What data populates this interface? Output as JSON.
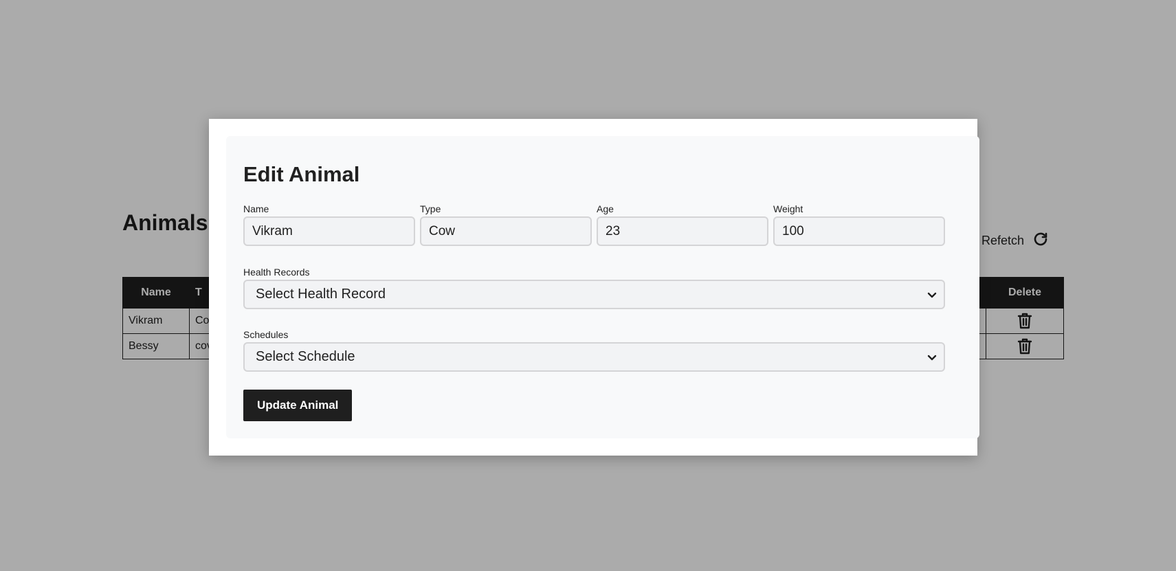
{
  "page": {
    "title": "Animals",
    "refetch_label": "Refetch",
    "refetch_icon": "refresh-icon"
  },
  "table": {
    "columns": [
      "Name",
      "T",
      "Delete"
    ],
    "rows": [
      {
        "name": "Vikram",
        "type": "Co"
      },
      {
        "name": "Bessy",
        "type": "cov"
      }
    ],
    "delete_icon": "trash-icon"
  },
  "modal": {
    "title": "Edit Animal",
    "fields": {
      "name": {
        "label": "Name",
        "value": "Vikram"
      },
      "type": {
        "label": "Type",
        "value": "Cow"
      },
      "age": {
        "label": "Age",
        "value": "23"
      },
      "weight": {
        "label": "Weight",
        "value": "100"
      }
    },
    "health_records": {
      "label": "Health Records",
      "selected": "Select Health Record"
    },
    "schedules": {
      "label": "Schedules",
      "selected": "Select Schedule"
    },
    "submit_label": "Update Animal"
  },
  "colors": {
    "overlay": "#ababab",
    "button_bg": "#1f1f1f",
    "table_header_bg": "#1e1e1e",
    "input_bg": "#f2f3f5"
  }
}
